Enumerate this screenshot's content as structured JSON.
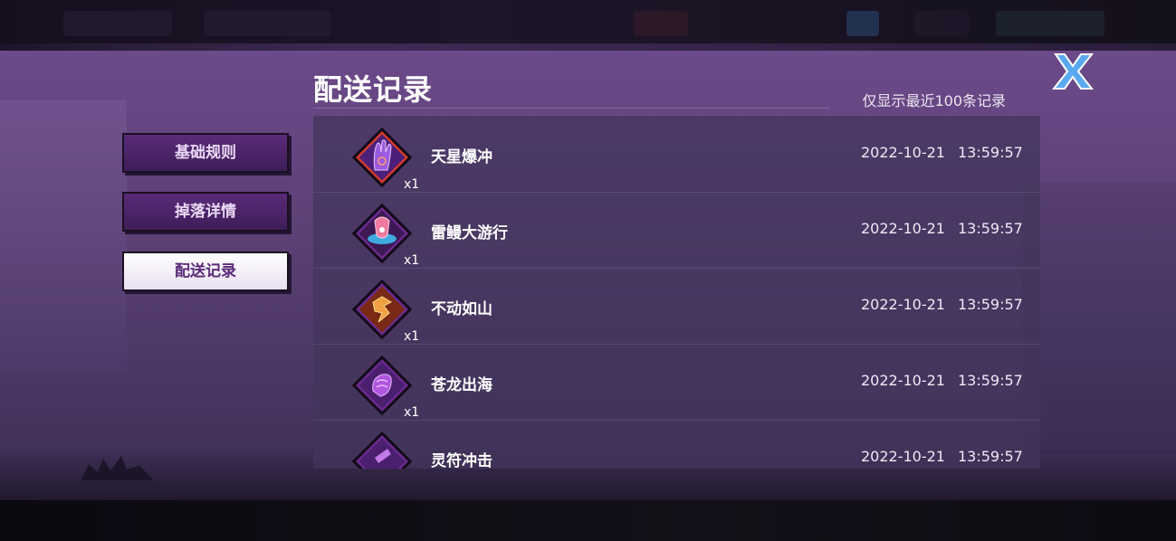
{
  "panel": {
    "title": "配送记录",
    "subtitle": "仅显示最近100条记录"
  },
  "tabs": [
    {
      "label": "基础规则",
      "active": false
    },
    {
      "label": "掉落详情",
      "active": false
    },
    {
      "label": "配送记录",
      "active": true
    }
  ],
  "records": [
    {
      "name": "天星爆冲",
      "qty": "x1",
      "date": "2022-10-21",
      "time": "13:59:57",
      "icon": "palm-skill-icon",
      "frame": "#d43a2e"
    },
    {
      "name": "雷鳗大游行",
      "qty": "x1",
      "date": "2022-10-21",
      "time": "13:59:57",
      "icon": "eel-parade-icon",
      "frame": "#6b2a8f"
    },
    {
      "name": "不动如山",
      "qty": "x1",
      "date": "2022-10-21",
      "time": "13:59:57",
      "icon": "mountain-rune-icon",
      "frame": "#6b2a8f"
    },
    {
      "name": "苍龙出海",
      "qty": "x1",
      "date": "2022-10-21",
      "time": "13:59:57",
      "icon": "dragon-fist-icon",
      "frame": "#6b2a8f"
    },
    {
      "name": "灵符冲击",
      "qty": "",
      "date": "2022-10-21",
      "time": "13:59:57",
      "icon": "talisman-icon",
      "frame": "#6b2a8f"
    }
  ],
  "colors": {
    "accent": "#7d3a9c",
    "panel": "#5e4279",
    "active_tab": "#ffffff"
  }
}
